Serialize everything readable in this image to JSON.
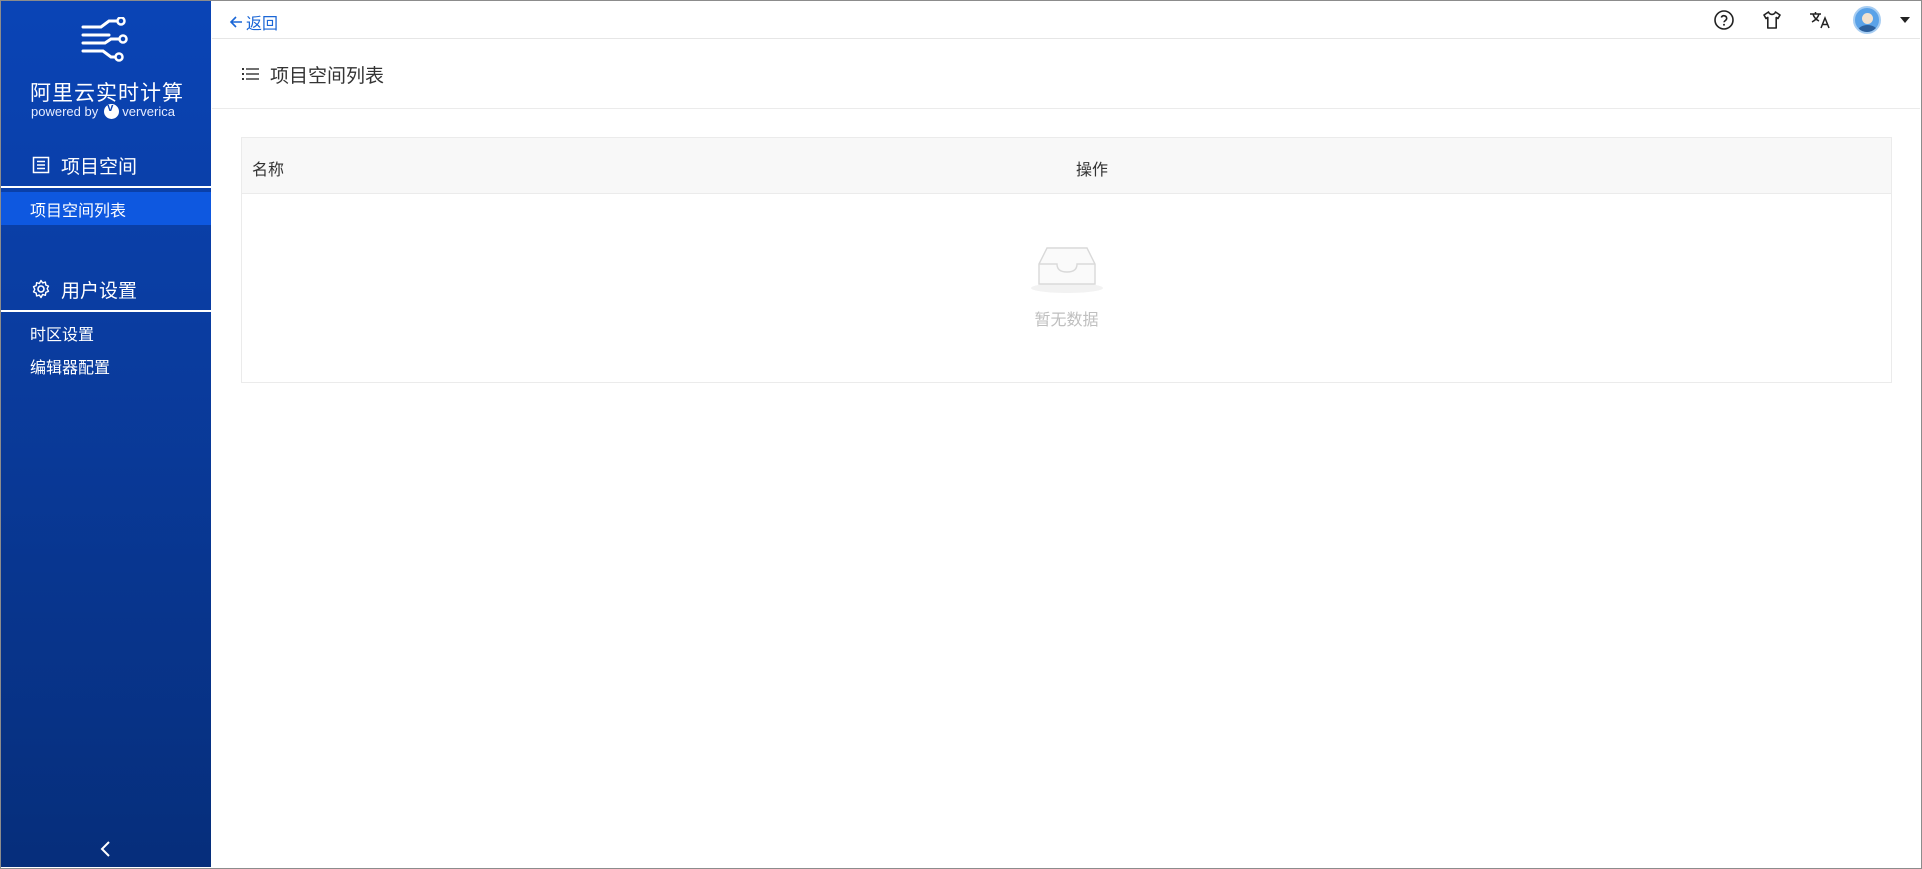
{
  "brand": {
    "title": "阿里云实时计算",
    "powered_by": "powered by",
    "partner": "ververica"
  },
  "sidebar": {
    "groups": [
      {
        "label": "项目空间",
        "icon": "list-box-icon",
        "items": [
          {
            "label": "项目空间列表",
            "active": true
          }
        ]
      },
      {
        "label": "用户设置",
        "icon": "gear-icon",
        "items": [
          {
            "label": "时区设置",
            "active": false
          },
          {
            "label": "编辑器配置",
            "active": false
          }
        ]
      }
    ],
    "collapse_icon": "chevron-left-icon"
  },
  "topbar": {
    "back_label": "返回",
    "icons": [
      "help-circle-icon",
      "shirt-icon",
      "translate-icon",
      "avatar",
      "caret-down-icon"
    ]
  },
  "page": {
    "title": "项目空间列表"
  },
  "table": {
    "columns": [
      "名称",
      "操作"
    ],
    "rows": [],
    "empty_text": "暂无数据"
  },
  "colors": {
    "sidebar_bg": "#0a44b6",
    "active_item": "#0e58e0",
    "link": "#1a66d6"
  }
}
